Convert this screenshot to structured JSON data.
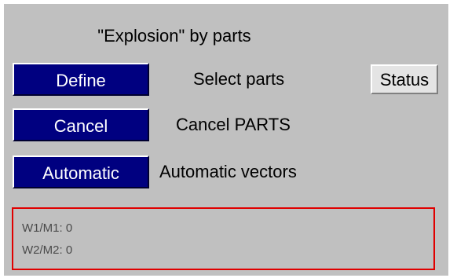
{
  "panel": {
    "title": "\"Explosion\" by parts"
  },
  "rows": [
    {
      "button_label": "Define",
      "description": "Select parts"
    },
    {
      "button_label": "Cancel",
      "description": "Cancel PARTS"
    },
    {
      "button_label": "Automatic",
      "description": "Automatic vectors"
    }
  ],
  "status_button": {
    "label": "Status"
  },
  "status_box": {
    "lines": [
      "W1/M1: 0",
      "W2/M2: 0"
    ]
  },
  "colors": {
    "panel_background": "#c0c0c0",
    "button_blue": "#000080",
    "button_text": "#ffffff",
    "status_border": "#e00000"
  }
}
